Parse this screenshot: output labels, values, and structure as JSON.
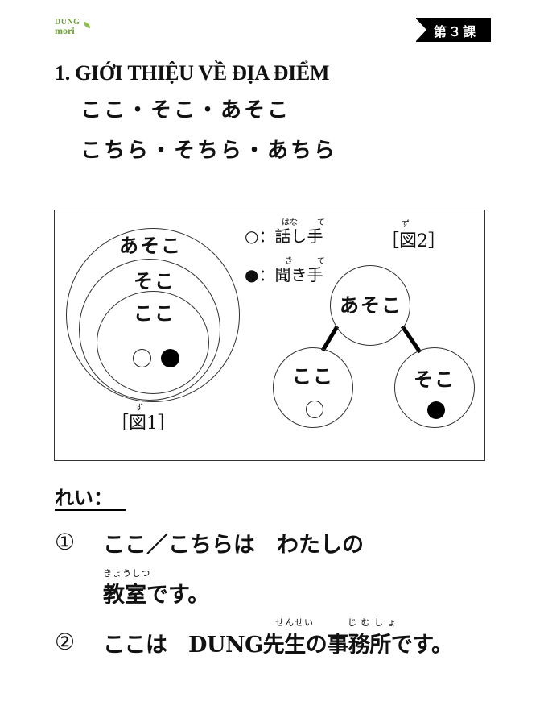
{
  "logo": {
    "line1": "DUNG",
    "line2": "mori"
  },
  "lesson_tag": "第３課",
  "section_title": "1. GIỚI THIỆU VỀ ĐỊA ĐIỂM",
  "lines": [
    "ここ・そこ・あそこ",
    "こちら・そちら・あちら"
  ],
  "diagram": {
    "fig1": {
      "outer": "あそこ",
      "middle": "そこ",
      "inner": "ここ",
      "label": "［図1］",
      "label_ruby": "ず"
    },
    "legend": {
      "speaker_symbol": "○",
      "speaker_label": "：話し手",
      "speaker_ruby": [
        "はな",
        "て"
      ],
      "listener_symbol": "●",
      "listener_label": "：聞き手",
      "listener_ruby": [
        "き",
        "て"
      ]
    },
    "fig2": {
      "label": "［図2］",
      "label_ruby": "ず",
      "top": "あそこ",
      "left": "ここ",
      "right": "そこ"
    }
  },
  "examples": {
    "heading": "れい：",
    "items": [
      {
        "number": "①",
        "line1": "ここ／こちらは　わたしの",
        "line2": "教室です。",
        "ruby": "きょうしつ"
      },
      {
        "number": "②",
        "line1": "ここは　DUNG先生の事務所です。",
        "ruby1": "せんせい",
        "ruby2": "じ む し ょ"
      }
    ]
  }
}
